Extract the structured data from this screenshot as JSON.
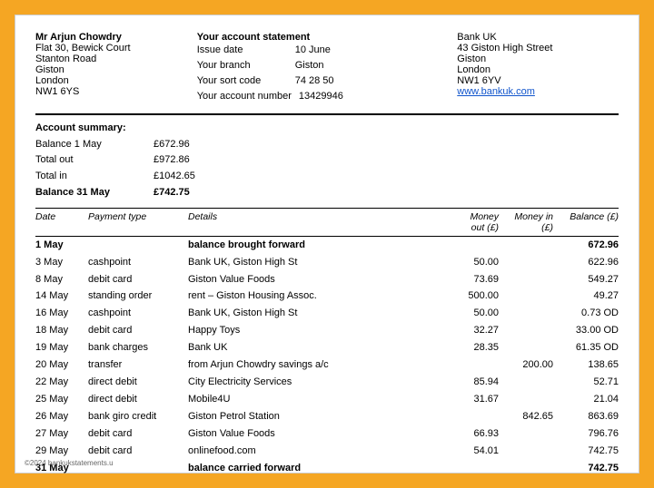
{
  "document": {
    "person": {
      "name": "Mr Arjun Chowdry",
      "address_line1": "Flat 30, Bewick Court",
      "address_line2": "Stanton Road",
      "address_line3": "Giston",
      "address_line4": "London",
      "address_line5": "NW1 6YS"
    },
    "account_statement": {
      "title": "Your account statement",
      "issue_date_label": "Issue date",
      "issue_date_value": "10 June",
      "branch_label": "Your branch",
      "branch_value": "Giston",
      "sort_code_label": "Your sort code",
      "sort_code_value": "74 28 50",
      "account_number_label": "Your account number",
      "account_number_value": "13429946"
    },
    "bank": {
      "name": "Bank UK",
      "address_line1": "43 Giston High Street",
      "address_line2": "Giston",
      "address_line3": "London",
      "address_line4": "NW1 6YV",
      "website": "www.bankuk.com"
    },
    "summary": {
      "title": "Account summary:",
      "balance_1may_label": "Balance 1 May",
      "balance_1may_value": "£672.96",
      "total_out_label": "Total out",
      "total_out_value": "£972.86",
      "total_in_label": "Total in",
      "total_in_value": "£1042.65",
      "balance_31may_label": "Balance 31 May",
      "balance_31may_value": "£742.75"
    },
    "table": {
      "headers": {
        "date": "Date",
        "payment_type": "Payment type",
        "details": "Details",
        "money_out": "Money out (£)",
        "money_in": "Money in (£)",
        "balance": "Balance (£)"
      },
      "rows": [
        {
          "date": "1 May",
          "type": "",
          "details": "balance brought forward",
          "out": "",
          "in": "",
          "balance": "672.96",
          "bold": true
        },
        {
          "date": "3 May",
          "type": "cashpoint",
          "details": "Bank UK, Giston High St",
          "out": "50.00",
          "in": "",
          "balance": "622.96",
          "bold": false
        },
        {
          "date": "8 May",
          "type": "debit card",
          "details": "Giston Value Foods",
          "out": "73.69",
          "in": "",
          "balance": "549.27",
          "bold": false
        },
        {
          "date": "14 May",
          "type": "standing order",
          "details": "rent – Giston Housing Assoc.",
          "out": "500.00",
          "in": "",
          "balance": "49.27",
          "bold": false
        },
        {
          "date": "16 May",
          "type": "cashpoint",
          "details": "Bank UK, Giston High St",
          "out": "50.00",
          "in": "",
          "balance": "0.73 OD",
          "bold": false
        },
        {
          "date": "18 May",
          "type": "debit card",
          "details": "Happy Toys",
          "out": "32.27",
          "in": "",
          "balance": "33.00 OD",
          "bold": false
        },
        {
          "date": "19 May",
          "type": "bank charges",
          "details": "Bank UK",
          "out": "28.35",
          "in": "",
          "balance": "61.35 OD",
          "bold": false
        },
        {
          "date": "20 May",
          "type": "transfer",
          "details": "from Arjun Chowdry savings a/c",
          "out": "",
          "in": "200.00",
          "balance": "138.65",
          "bold": false
        },
        {
          "date": "22 May",
          "type": "direct debit",
          "details": "City Electricity Services",
          "out": "85.94",
          "in": "",
          "balance": "52.71",
          "bold": false
        },
        {
          "date": "25 May",
          "type": "direct debit",
          "details": "Mobile4U",
          "out": "31.67",
          "in": "",
          "balance": "21.04",
          "bold": false
        },
        {
          "date": "26 May",
          "type": "bank giro credit",
          "details": "Giston Petrol Station",
          "out": "",
          "in": "842.65",
          "balance": "863.69",
          "bold": false
        },
        {
          "date": "27 May",
          "type": "debit card",
          "details": "Giston Value Foods",
          "out": "66.93",
          "in": "",
          "balance": "796.76",
          "bold": false
        },
        {
          "date": "29 May",
          "type": "debit card",
          "details": "onlinefood.com",
          "out": "54.01",
          "in": "",
          "balance": "742.75",
          "bold": false
        },
        {
          "date": "31 May",
          "type": "",
          "details": "balance carried forward",
          "out": "",
          "in": "",
          "balance": "742.75",
          "bold": true
        }
      ]
    },
    "footer": "©2024 bankukstatements.u"
  }
}
